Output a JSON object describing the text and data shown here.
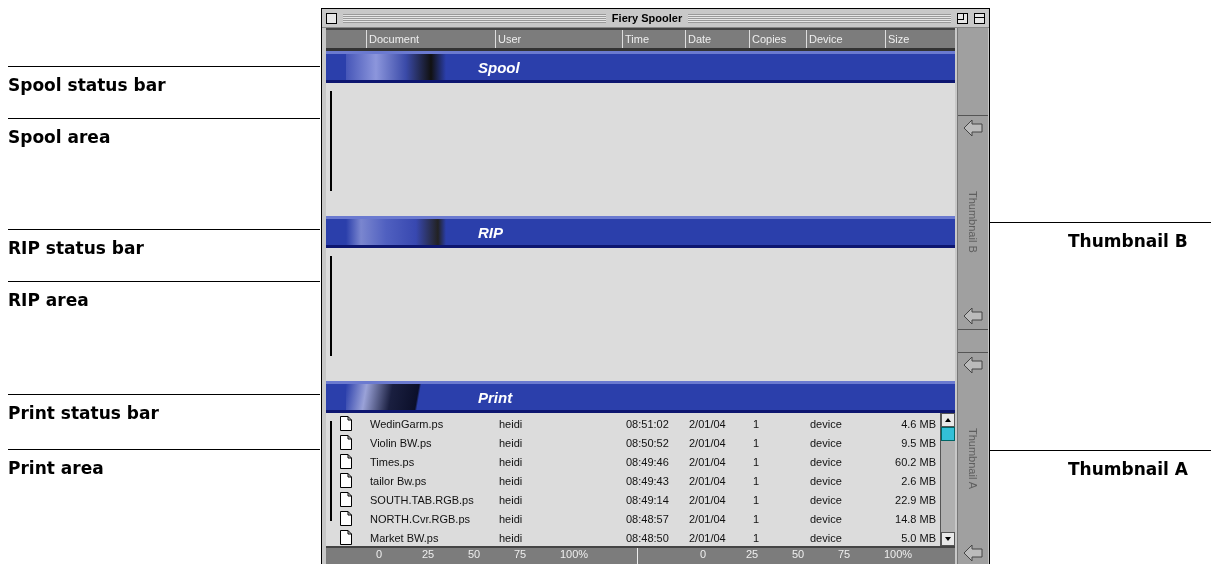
{
  "callouts_left": [
    {
      "label": "Spool status bar"
    },
    {
      "label": "Spool area"
    },
    {
      "label": "RIP status bar"
    },
    {
      "label": "RIP area"
    },
    {
      "label": "Print status bar"
    },
    {
      "label": "Print area"
    }
  ],
  "callouts_right": [
    {
      "label": "Thumbnail B"
    },
    {
      "label": "Thumbnail A"
    }
  ],
  "window": {
    "title": "Fiery Spooler"
  },
  "columns": [
    "Document",
    "User",
    "Time",
    "Date",
    "Copies",
    "Device",
    "Size"
  ],
  "sections": [
    {
      "kind": "spool",
      "title": "Spool"
    },
    {
      "kind": "rip",
      "title": "RIP"
    },
    {
      "kind": "print",
      "title": "Print",
      "jobs": [
        [
          "WedinGarm.ps",
          "heidi",
          "08:51:02",
          "2/01/04",
          "1",
          "device",
          "4.6 MB"
        ],
        [
          "Violin BW.ps",
          "heidi",
          "08:50:52",
          "2/01/04",
          "1",
          "device",
          "9.5 MB"
        ],
        [
          "Times.ps",
          "heidi",
          "08:49:46",
          "2/01/04",
          "1",
          "device",
          "60.2 MB"
        ],
        [
          "tailor Bw.ps",
          "heidi",
          "08:49:43",
          "2/01/04",
          "1",
          "device",
          "2.6 MB"
        ],
        [
          "SOUTH.TAB.RGB.ps",
          "heidi",
          "08:49:14",
          "2/01/04",
          "1",
          "device",
          "22.9 MB"
        ],
        [
          "NORTH.Cvr.RGB.ps",
          "heidi",
          "08:48:57",
          "2/01/04",
          "1",
          "device",
          "14.8 MB"
        ],
        [
          "Market BW.ps",
          "heidi",
          "08:48:50",
          "2/01/04",
          "1",
          "device",
          "5.0 MB"
        ]
      ]
    }
  ],
  "scales": [
    {
      "ticks": [
        "0",
        "25",
        "50",
        "75",
        "100%"
      ]
    },
    {
      "ticks": [
        "0",
        "25",
        "50",
        "75",
        "100%"
      ]
    }
  ],
  "thumbnails": [
    {
      "label": "Thumbnail B"
    },
    {
      "label": "Thumbnail A"
    }
  ]
}
